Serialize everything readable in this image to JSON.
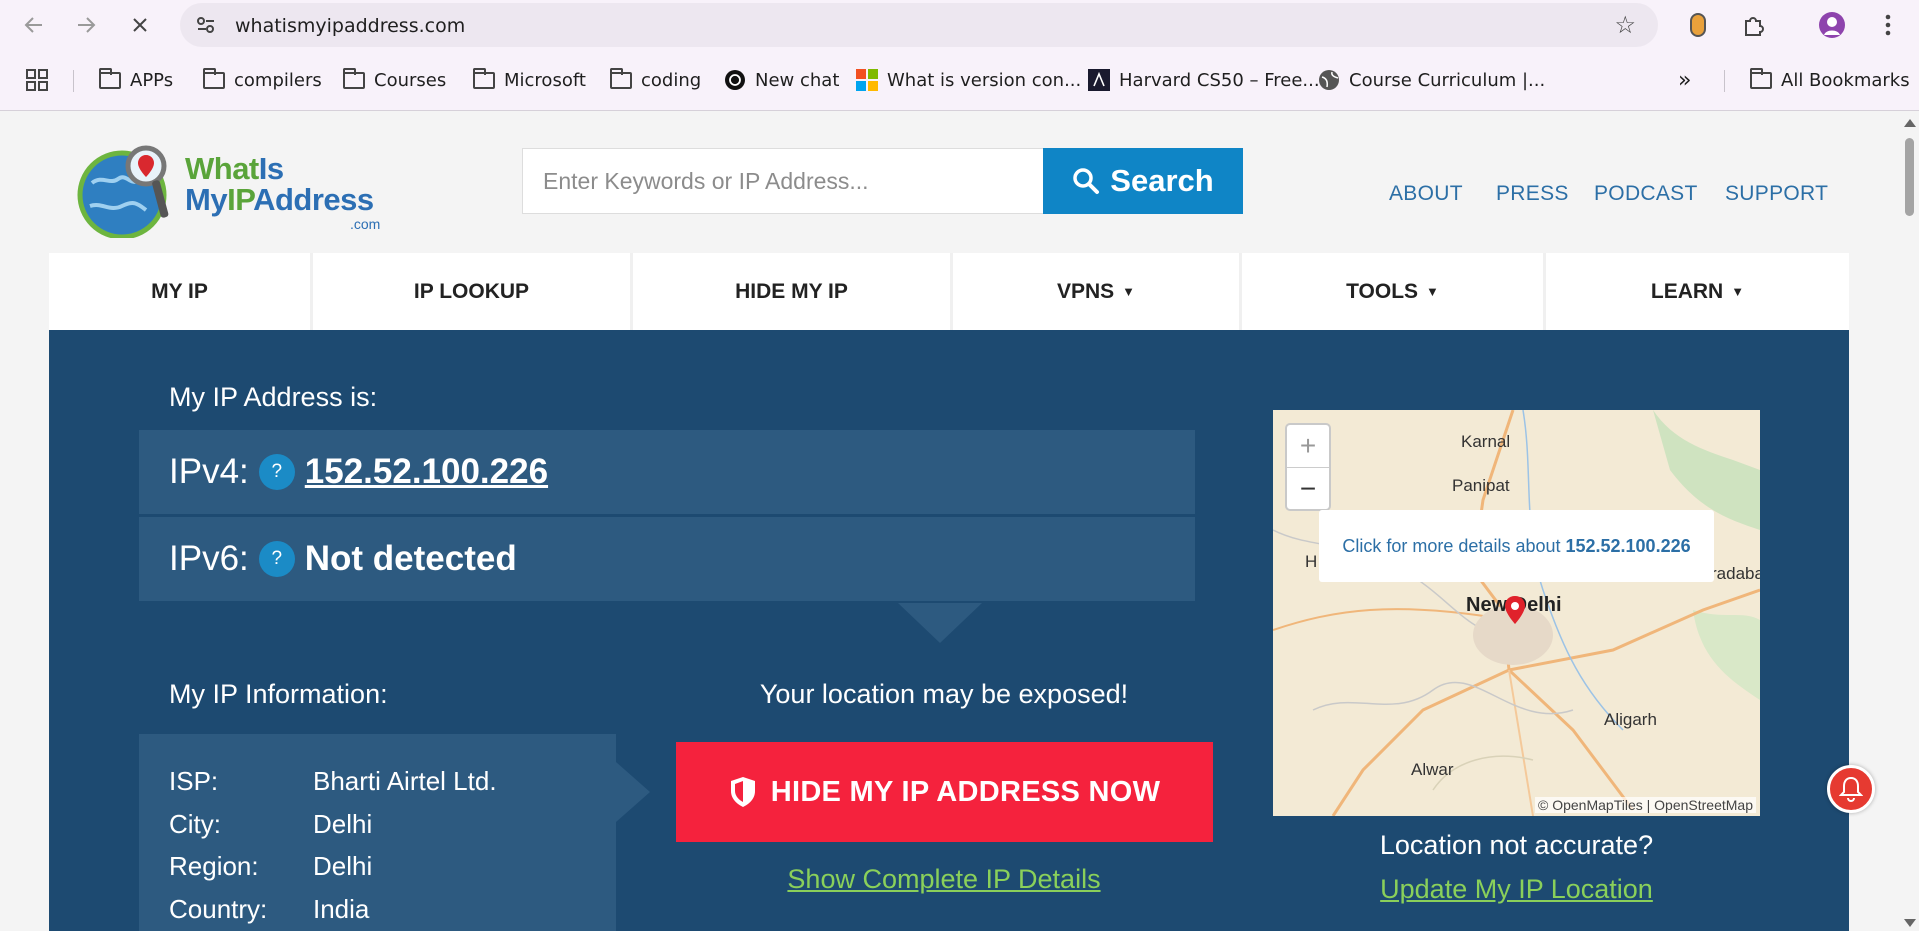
{
  "browser": {
    "url": "whatismyipaddress.com",
    "bookmarks": [
      {
        "label": "APPs",
        "icon": "folder-icon"
      },
      {
        "label": "compilers",
        "icon": "folder-icon"
      },
      {
        "label": "Courses",
        "icon": "folder-icon"
      },
      {
        "label": "Microsoft",
        "icon": "folder-icon"
      },
      {
        "label": "coding",
        "icon": "folder-icon"
      },
      {
        "label": "New chat",
        "icon": "chatgpt-icon"
      },
      {
        "label": "What is version con...",
        "icon": "microsoft-icon"
      },
      {
        "label": "Harvard CS50 – Free...",
        "icon": "cs50-icon"
      },
      {
        "label": "Course Curriculum |...",
        "icon": "globe-icon"
      }
    ],
    "overflow_label": "»",
    "all_bookmarks": "All Bookmarks"
  },
  "site": {
    "logo_line1_a": "What",
    "logo_line1_b": "Is",
    "logo_line2_a": "My",
    "logo_line2_b": "IP",
    "logo_line2_c": "Address",
    "logo_com": ".com",
    "search_placeholder": "Enter Keywords or IP Address...",
    "search_button": "Search",
    "top_links": [
      "ABOUT",
      "PRESS",
      "PODCAST",
      "SUPPORT"
    ],
    "nav": [
      {
        "label": "MY IP",
        "caret": ""
      },
      {
        "label": "IP LOOKUP",
        "caret": ""
      },
      {
        "label": "HIDE MY IP",
        "caret": ""
      },
      {
        "label": "VPNS",
        "caret": "▼"
      },
      {
        "label": "TOOLS",
        "caret": "▼"
      },
      {
        "label": "LEARN",
        "caret": "▼"
      }
    ]
  },
  "hero": {
    "my_ip_label": "My IP Address is:",
    "ipv4_label": "IPv4:",
    "ipv4_value": "152.52.100.226",
    "ipv6_label": "IPv6:",
    "ipv6_value": "Not detected",
    "help_glyph": "?",
    "info_label": "My IP Information:",
    "info": [
      {
        "key": "ISP:",
        "value": "Bharti Airtel Ltd."
      },
      {
        "key": "City:",
        "value": "Delhi"
      },
      {
        "key": "Region:",
        "value": "Delhi"
      },
      {
        "key": "Country:",
        "value": "India"
      }
    ],
    "exposed_text": "Your location may be exposed!",
    "hide_button": "HIDE MY IP ADDRESS NOW",
    "show_details": "Show Complete IP Details",
    "location_question": "Location not accurate?",
    "update_location": "Update My IP Location"
  },
  "map": {
    "zoom_in": "+",
    "zoom_out": "−",
    "popup_text": "Click for more details about",
    "popup_ip": "152.52.100.226",
    "cities": [
      "Karnal",
      "Panipat",
      "New Delhi",
      "Aligarh",
      "Alwar",
      "H",
      "radaba"
    ],
    "attribution": "© OpenMapTiles | OpenStreetMap"
  },
  "colors": {
    "hero_bg": "#1d4a71",
    "row_bg": "#2d5a80",
    "search_blue": "#0f85c6",
    "hide_red": "#f5223d",
    "link_green": "#8ad05a"
  }
}
